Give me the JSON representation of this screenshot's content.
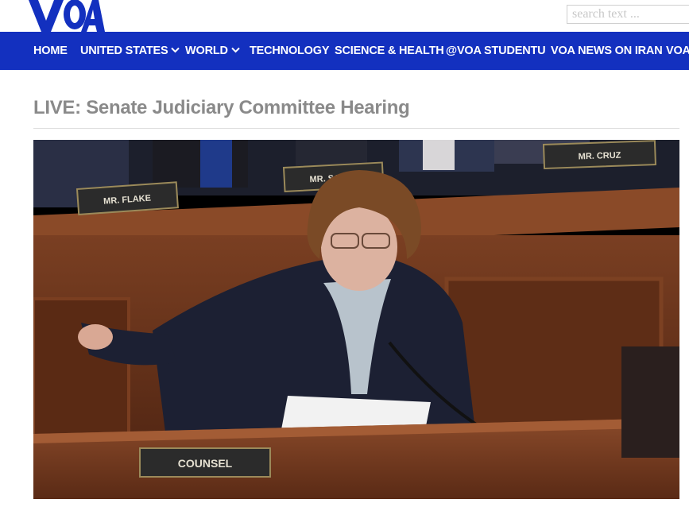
{
  "header": {
    "logo_text": "VOA",
    "search_placeholder": "search text ..."
  },
  "nav": {
    "items": [
      {
        "label": "HOME"
      },
      {
        "label": "UNITED STATES"
      },
      {
        "label": "WORLD"
      },
      {
        "label": "TECHNOLOGY"
      },
      {
        "label": "SCIENCE & HEALTH"
      },
      {
        "label": "@VOA STUDENTU"
      },
      {
        "label": "VOA NEWS ON IRAN"
      },
      {
        "label": "VOA"
      }
    ]
  },
  "page": {
    "title": "LIVE: Senate Judiciary Committee Hearing"
  },
  "video": {
    "nameplates": {
      "flake": "MR. FLAKE",
      "sasse": "MR. SASSE",
      "cruz": "MR. CRUZ",
      "counsel": "COUNSEL"
    }
  },
  "colors": {
    "nav_background": "#1330bf",
    "title_text": "#8a8a8a",
    "brand_blue": "#1330bf"
  }
}
